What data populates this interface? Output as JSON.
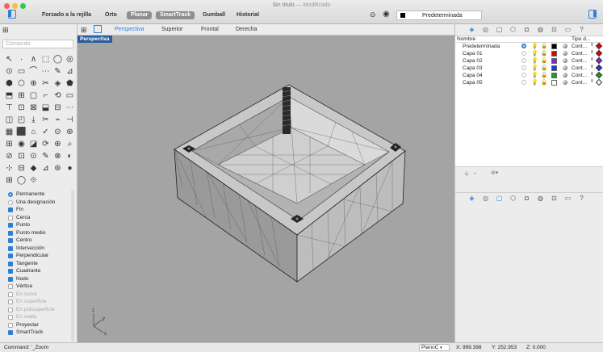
{
  "window": {
    "title": "Sin título",
    "subtitle": "— Modificado"
  },
  "toolbar": {
    "grid_snap": "Forzado a la rejilla",
    "ortho": "Orto",
    "planar": "Planar",
    "smarttrack": "SmartTrack",
    "gumball": "Gumball",
    "history": "Historial",
    "current_layer": "Predeterminada",
    "current_layer_color": "#000000"
  },
  "left": {
    "search_placeholder": "Comando",
    "tools": [
      "↖",
      "·",
      "∧",
      "⬚",
      "◯",
      "◎",
      "⊙",
      "▭",
      "⌒",
      "⋯",
      "✎",
      "⊿",
      "⬢",
      "⬡",
      "⊕",
      "✂",
      "◈",
      "⬟",
      "⬒",
      "⊞",
      "▢",
      "⌐",
      "⟲",
      "▭",
      "⊤",
      "⊡",
      "⊠",
      "⬓",
      "⊟",
      "⋯",
      "◫",
      "◰",
      "⤓",
      "✂",
      "⌁",
      "⊣",
      "▦",
      "⬛",
      "⌂",
      "✓",
      "⊝",
      "⊛",
      "⊞",
      "◉",
      "◪",
      "⟳",
      "⊕",
      "⌕",
      "⊘",
      "⊡",
      "⊙",
      "✎",
      "⊗",
      "◐",
      "⊹",
      "⊟",
      "◆",
      "⊿",
      "⊛",
      "●",
      "⊞",
      "◯",
      "⟐"
    ],
    "snaps": [
      {
        "label": "Permanente",
        "kind": "radio",
        "on": true
      },
      {
        "label": "Una designación",
        "kind": "radio",
        "on": false
      },
      {
        "label": "Fin",
        "kind": "check",
        "on": true
      },
      {
        "label": "Cerca",
        "kind": "check",
        "on": false
      },
      {
        "label": "Punto",
        "kind": "check",
        "on": true
      },
      {
        "label": "Punto medio",
        "kind": "check",
        "on": true
      },
      {
        "label": "Centro",
        "kind": "check",
        "on": true
      },
      {
        "label": "Intersección",
        "kind": "check",
        "on": true
      },
      {
        "label": "Perpendicular",
        "kind": "check",
        "on": true
      },
      {
        "label": "Tangente",
        "kind": "check",
        "on": true
      },
      {
        "label": "Cuadrante",
        "kind": "check",
        "on": true
      },
      {
        "label": "Nodo",
        "kind": "check",
        "on": true
      },
      {
        "label": "Vértice",
        "kind": "check",
        "on": false
      },
      {
        "label": "En curva",
        "kind": "check",
        "on": false,
        "disabled": true
      },
      {
        "label": "En superficie",
        "kind": "check",
        "on": false,
        "disabled": true
      },
      {
        "label": "En polisuperficie",
        "kind": "check",
        "on": false,
        "disabled": true
      },
      {
        "label": "En malla",
        "kind": "check",
        "on": false,
        "disabled": true
      },
      {
        "label": "Proyectar",
        "kind": "check",
        "on": false
      },
      {
        "label": "SmartTrack",
        "kind": "check",
        "on": true
      }
    ]
  },
  "viewtabs": [
    "Perspectiva",
    "Superior",
    "Frontal",
    "Derecha"
  ],
  "viewport": {
    "label": "Perspectiva",
    "axis_x": "x",
    "axis_y": "y",
    "axis_z": "z"
  },
  "layers": {
    "col_name": "Nombre",
    "col_type": "Tipo d...",
    "rows": [
      {
        "name": "Predeterminada",
        "current": true,
        "color": "#000000",
        "type": "Cont..."
      },
      {
        "name": "Capa 01",
        "current": false,
        "color": "#e00000",
        "type": "Cont..."
      },
      {
        "name": "Capa 02",
        "current": false,
        "color": "#7a2ad8",
        "type": "Cont..."
      },
      {
        "name": "Capa 03",
        "current": false,
        "color": "#1e3ad8",
        "type": "Cont..."
      },
      {
        "name": "Capa 04",
        "current": false,
        "color": "#1ca01c",
        "type": "Cont..."
      },
      {
        "name": "Capa 05",
        "current": false,
        "color": "#ffffff",
        "type": "Cont..."
      }
    ],
    "diamond_colors": [
      "#e00000",
      "#e00000",
      "#7a2ad8",
      "#1e3ad8",
      "#1ca01c",
      "#ffffff"
    ]
  },
  "status": {
    "command": "Command: '_Zoom",
    "plane": "PlanoC",
    "x": "X: 999.398",
    "y": "Y: 252.953",
    "z": "Z: 0.000"
  }
}
